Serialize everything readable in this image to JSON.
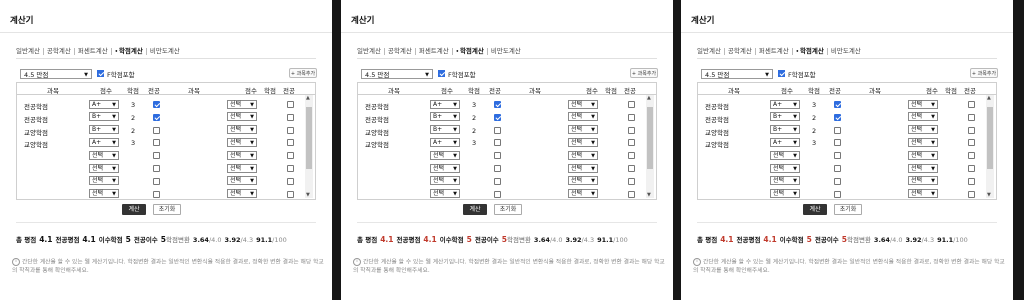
{
  "panels": [
    {
      "title": "계산기",
      "tabs": [
        "일반계산",
        "공학계산",
        "퍼센트계산",
        "학점계산",
        "비만도계산"
      ],
      "active_tab": 3,
      "scale_value": "4.5 만점",
      "f_grade_label": "F학점포함",
      "f_grade_checked": true,
      "add_subject_label": "+ 과목추가",
      "headers": {
        "subject": "과목",
        "grade": "점수",
        "credit": "학점",
        "major": "전공"
      },
      "rows": [
        {
          "name": "전공학점",
          "grade": "A+",
          "credit": "3",
          "major": true
        },
        {
          "name": "전공학점",
          "grade": "B+",
          "credit": "2",
          "major": true
        },
        {
          "name": "교양학점",
          "grade": "B+",
          "credit": "2",
          "major": false
        },
        {
          "name": "교양학점",
          "grade": "A+",
          "credit": "3",
          "major": false
        },
        {
          "name": "",
          "grade": "선택",
          "credit": "",
          "major": false
        },
        {
          "name": "",
          "grade": "선택",
          "credit": "",
          "major": false
        },
        {
          "name": "",
          "grade": "선택",
          "credit": "",
          "major": false
        },
        {
          "name": "",
          "grade": "선택",
          "credit": "",
          "major": false
        }
      ],
      "right_rows": [
        "선택",
        "선택",
        "선택",
        "선택",
        "선택",
        "선택",
        "선택",
        "선택"
      ],
      "calc_label": "계산",
      "reset_label": "초기화",
      "results": {
        "total_label": "총 평점",
        "total_value": "4.1",
        "major_label": "전공평점",
        "major_value": "4.1",
        "credits_label": "이수학점",
        "credits_value": "5",
        "major_credits_label": "전공이수",
        "major_credits_value": "5",
        "convert_label": "학점변환",
        "s1": "3.64",
        "s1_scale": "/4.0",
        "s2": "3.92",
        "s2_scale": "/4.3",
        "s3": "91.1",
        "s3_scale": "/100",
        "red_values": false
      },
      "notice": "간단한 계산을 할 수 있는 웹 계산기입니다. 학점변환 결과는 일반적인 변환식을 적용한 결과로, 정확한 변환 결과는 해당 학교의 학칙과를 통해 확인해주세요."
    },
    {
      "title": "계산기",
      "tabs": [
        "일반계산",
        "공학계산",
        "퍼센트계산",
        "학점계산",
        "비만도계산"
      ],
      "active_tab": 3,
      "scale_value": "4.5 만점",
      "f_grade_label": "F학점포함",
      "f_grade_checked": true,
      "add_subject_label": "+ 과목추가",
      "headers": {
        "subject": "과목",
        "grade": "점수",
        "credit": "학점",
        "major": "전공"
      },
      "rows": [
        {
          "name": "전공학점",
          "grade": "A+",
          "credit": "3",
          "major": true
        },
        {
          "name": "전공학점",
          "grade": "B+",
          "credit": "2",
          "major": true
        },
        {
          "name": "교양학점",
          "grade": "B+",
          "credit": "2",
          "major": false
        },
        {
          "name": "교양학점",
          "grade": "A+",
          "credit": "3",
          "major": false
        },
        {
          "name": "",
          "grade": "선택",
          "credit": "",
          "major": false
        },
        {
          "name": "",
          "grade": "선택",
          "credit": "",
          "major": false
        },
        {
          "name": "",
          "grade": "선택",
          "credit": "",
          "major": false
        },
        {
          "name": "",
          "grade": "선택",
          "credit": "",
          "major": false
        }
      ],
      "right_rows": [
        "선택",
        "선택",
        "선택",
        "선택",
        "선택",
        "선택",
        "선택",
        "선택"
      ],
      "calc_label": "계산",
      "reset_label": "초기화",
      "results": {
        "total_label": "총 평점",
        "total_value": "4.1",
        "major_label": "전공평점",
        "major_value": "4.1",
        "credits_label": "이수학점",
        "credits_value": "5",
        "major_credits_label": "전공이수",
        "major_credits_value": "5",
        "convert_label": "학점변환",
        "s1": "3.64",
        "s1_scale": "/4.0",
        "s2": "3.92",
        "s2_scale": "/4.3",
        "s3": "91.1",
        "s3_scale": "/100",
        "red_values": true
      },
      "notice": "간단한 계산을 할 수 있는 웹 계산기입니다. 학점변환 결과는 일반적인 변환식을 적용한 결과로, 정확한 변환 결과는 해당 학교의 학칙과를 통해 확인해주세요."
    },
    {
      "title": "계산기",
      "tabs": [
        "일반계산",
        "공학계산",
        "퍼센트계산",
        "학점계산",
        "비만도계산"
      ],
      "active_tab": 3,
      "scale_value": "4.5 만점",
      "f_grade_label": "F학점포함",
      "f_grade_checked": true,
      "add_subject_label": "+ 과목추가",
      "headers": {
        "subject": "과목",
        "grade": "점수",
        "credit": "학점",
        "major": "전공"
      },
      "rows": [
        {
          "name": "전공학점",
          "grade": "A+",
          "credit": "3",
          "major": true
        },
        {
          "name": "전공학점",
          "grade": "B+",
          "credit": "2",
          "major": true
        },
        {
          "name": "교양학점",
          "grade": "B+",
          "credit": "2",
          "major": false
        },
        {
          "name": "교양학점",
          "grade": "A+",
          "credit": "3",
          "major": false
        },
        {
          "name": "",
          "grade": "선택",
          "credit": "",
          "major": false
        },
        {
          "name": "",
          "grade": "선택",
          "credit": "",
          "major": false
        },
        {
          "name": "",
          "grade": "선택",
          "credit": "",
          "major": false
        },
        {
          "name": "",
          "grade": "선택",
          "credit": "",
          "major": false
        }
      ],
      "right_rows": [
        "선택",
        "선택",
        "선택",
        "선택",
        "선택",
        "선택",
        "선택",
        "선택"
      ],
      "calc_label": "계산",
      "reset_label": "초기화",
      "results": {
        "total_label": "총 평점",
        "total_value": "4.1",
        "major_label": "전공평점",
        "major_value": "4.1",
        "credits_label": "이수학점",
        "credits_value": "5",
        "major_credits_label": "전공이수",
        "major_credits_value": "5",
        "convert_label": "학점변환",
        "s1": "3.64",
        "s1_scale": "/4.0",
        "s2": "3.92",
        "s2_scale": "/4.3",
        "s3": "91.1",
        "s3_scale": "/100",
        "red_values": true
      },
      "notice": "간단한 계산을 할 수 있는 웹 계산기입니다. 학점변환 결과는 일반적인 변환식을 적용한 결과로, 정확한 변환 결과는 해당 학교의 학칙과를 통해 확인해주세요."
    }
  ],
  "colors": {
    "accent": "#2d6cdf",
    "result_red": "#c0392b",
    "calc_button": "#333333",
    "add_plus": "#1a9c3a"
  }
}
